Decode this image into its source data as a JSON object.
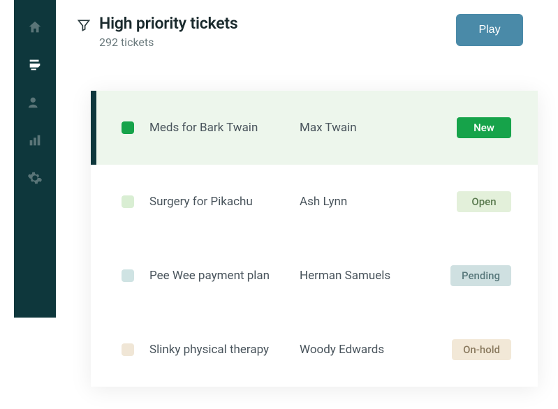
{
  "sidebar": {
    "items": [
      {
        "name": "home",
        "active": false
      },
      {
        "name": "tickets",
        "active": true
      },
      {
        "name": "customers",
        "active": false
      },
      {
        "name": "reports",
        "active": false
      },
      {
        "name": "settings",
        "active": false
      }
    ]
  },
  "header": {
    "title": "High priority tickets",
    "subtitle": "292 tickets",
    "play_label": "Play"
  },
  "status_styles": {
    "new": {
      "square": "#16a34a",
      "badge_bg": "#16a34a",
      "badge_fg": "#ffffff",
      "label": "New"
    },
    "open": {
      "square": "#d9eed3",
      "badge_bg": "#e3f0da",
      "badge_fg": "#5a7a4f",
      "label": "Open"
    },
    "pending": {
      "square": "#cfe3e3",
      "badge_bg": "#cfe0e1",
      "badge_fg": "#5a7a7d",
      "label": "Pending"
    },
    "on-hold": {
      "square": "#f0e6d6",
      "badge_bg": "#f2e8d7",
      "badge_fg": "#8a7a5f",
      "label": "On-hold"
    }
  },
  "tickets": [
    {
      "subject": "Meds for Bark Twain",
      "requester": "Max Twain",
      "status": "new",
      "selected": true
    },
    {
      "subject": "Surgery for Pikachu",
      "requester": "Ash Lynn",
      "status": "open",
      "selected": false
    },
    {
      "subject": "Pee Wee payment plan",
      "requester": "Herman Samuels",
      "status": "pending",
      "selected": false
    },
    {
      "subject": "Slinky physical therapy",
      "requester": "Woody Edwards",
      "status": "on-hold",
      "selected": false
    }
  ]
}
